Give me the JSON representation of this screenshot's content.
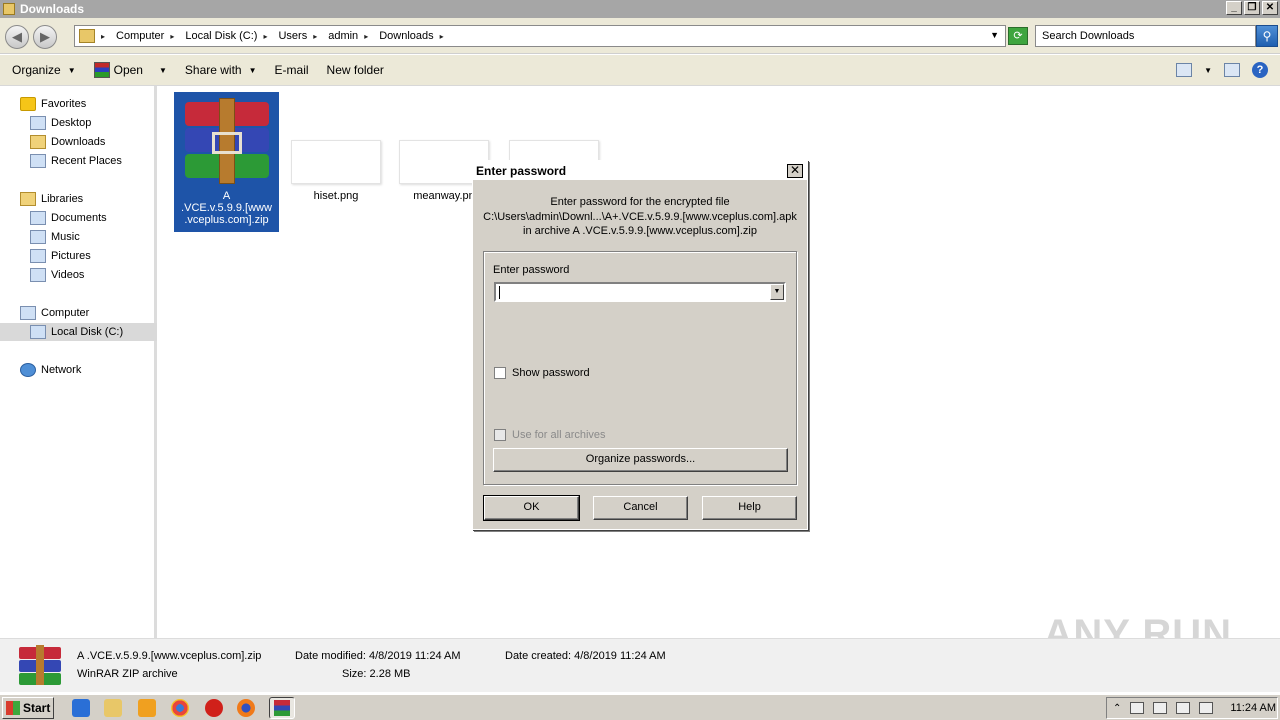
{
  "window": {
    "title": "Downloads"
  },
  "address": {
    "crumbs": [
      "Computer",
      "Local Disk (C:)",
      "Users",
      "admin",
      "Downloads"
    ],
    "search_placeholder": "Search Downloads"
  },
  "toolbar": {
    "organize": "Organize",
    "open": "Open",
    "share_with": "Share with",
    "email": "E-mail",
    "new_folder": "New folder"
  },
  "nav": {
    "favorites": "Favorites",
    "desktop": "Desktop",
    "downloads": "Downloads",
    "recent_places": "Recent Places",
    "libraries": "Libraries",
    "documents": "Documents",
    "music": "Music",
    "pictures": "Pictures",
    "videos": "Videos",
    "computer": "Computer",
    "local_disk": "Local Disk (C:)",
    "network": "Network"
  },
  "files": [
    {
      "name": "A .VCE.v.5.9.9.[www.vceplus.com].zip",
      "line1": "A",
      "line2": ".VCE.v.5.9.9.[www",
      "line3": ".vceplus.com].zip"
    },
    {
      "name": "hiset.png"
    },
    {
      "name": "meanway.pn"
    }
  ],
  "dialog": {
    "title": "Enter password",
    "msg_line1": "Enter password for the encrypted file",
    "msg_line2": "C:\\Users\\admin\\Downl...\\A+.VCE.v.5.9.9.[www.vceplus.com].apk",
    "msg_line3": "in archive A .VCE.v.5.9.9.[www.vceplus.com].zip",
    "field_label": "Enter password",
    "password_value": "",
    "show_password": "Show password",
    "show_password_checked": false,
    "use_for_all": "Use for all archives",
    "use_for_all_enabled": false,
    "organize_passwords": "Organize passwords...",
    "ok": "OK",
    "cancel": "Cancel",
    "help": "Help"
  },
  "details": {
    "filename": "A .VCE.v.5.9.9.[www.vceplus.com].zip",
    "type": "WinRAR ZIP archive",
    "date_modified_label": "Date modified:",
    "date_modified": "4/8/2019 11:24 AM",
    "date_created_label": "Date created:",
    "date_created": "4/8/2019 11:24 AM",
    "size_label": "Size:",
    "size": "2.28 MB"
  },
  "watermark": "ANY RUN",
  "taskbar": {
    "start": "Start",
    "clock": "11:24 AM"
  }
}
